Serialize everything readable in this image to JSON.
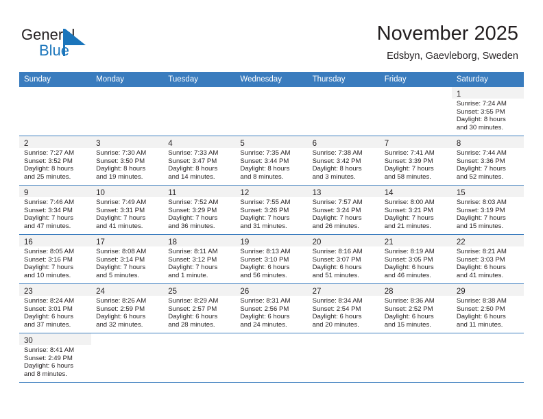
{
  "brand": {
    "line1": "General",
    "line2": "Blue",
    "triangle_color": "#1b75bb",
    "text_color": "#231f20"
  },
  "header": {
    "title": "November 2025",
    "subtitle": "Edsbyn, Gaevleborg, Sweden"
  },
  "theme": {
    "header_bg": "#3a7cbe",
    "header_text": "#ffffff",
    "daynum_bg": "#f2f2f2",
    "row_border": "#3a7cbe",
    "body_text": "#231f20"
  },
  "weekdays": [
    "Sunday",
    "Monday",
    "Tuesday",
    "Wednesday",
    "Thursday",
    "Friday",
    "Saturday"
  ],
  "weeks": [
    [
      {
        "day": "",
        "sunrise": "",
        "sunset": "",
        "daylight1": "",
        "daylight2": ""
      },
      {
        "day": "",
        "sunrise": "",
        "sunset": "",
        "daylight1": "",
        "daylight2": ""
      },
      {
        "day": "",
        "sunrise": "",
        "sunset": "",
        "daylight1": "",
        "daylight2": ""
      },
      {
        "day": "",
        "sunrise": "",
        "sunset": "",
        "daylight1": "",
        "daylight2": ""
      },
      {
        "day": "",
        "sunrise": "",
        "sunset": "",
        "daylight1": "",
        "daylight2": ""
      },
      {
        "day": "",
        "sunrise": "",
        "sunset": "",
        "daylight1": "",
        "daylight2": ""
      },
      {
        "day": "1",
        "sunrise": "Sunrise: 7:24 AM",
        "sunset": "Sunset: 3:55 PM",
        "daylight1": "Daylight: 8 hours",
        "daylight2": "and 30 minutes."
      }
    ],
    [
      {
        "day": "2",
        "sunrise": "Sunrise: 7:27 AM",
        "sunset": "Sunset: 3:52 PM",
        "daylight1": "Daylight: 8 hours",
        "daylight2": "and 25 minutes."
      },
      {
        "day": "3",
        "sunrise": "Sunrise: 7:30 AM",
        "sunset": "Sunset: 3:50 PM",
        "daylight1": "Daylight: 8 hours",
        "daylight2": "and 19 minutes."
      },
      {
        "day": "4",
        "sunrise": "Sunrise: 7:33 AM",
        "sunset": "Sunset: 3:47 PM",
        "daylight1": "Daylight: 8 hours",
        "daylight2": "and 14 minutes."
      },
      {
        "day": "5",
        "sunrise": "Sunrise: 7:35 AM",
        "sunset": "Sunset: 3:44 PM",
        "daylight1": "Daylight: 8 hours",
        "daylight2": "and 8 minutes."
      },
      {
        "day": "6",
        "sunrise": "Sunrise: 7:38 AM",
        "sunset": "Sunset: 3:42 PM",
        "daylight1": "Daylight: 8 hours",
        "daylight2": "and 3 minutes."
      },
      {
        "day": "7",
        "sunrise": "Sunrise: 7:41 AM",
        "sunset": "Sunset: 3:39 PM",
        "daylight1": "Daylight: 7 hours",
        "daylight2": "and 58 minutes."
      },
      {
        "day": "8",
        "sunrise": "Sunrise: 7:44 AM",
        "sunset": "Sunset: 3:36 PM",
        "daylight1": "Daylight: 7 hours",
        "daylight2": "and 52 minutes."
      }
    ],
    [
      {
        "day": "9",
        "sunrise": "Sunrise: 7:46 AM",
        "sunset": "Sunset: 3:34 PM",
        "daylight1": "Daylight: 7 hours",
        "daylight2": "and 47 minutes."
      },
      {
        "day": "10",
        "sunrise": "Sunrise: 7:49 AM",
        "sunset": "Sunset: 3:31 PM",
        "daylight1": "Daylight: 7 hours",
        "daylight2": "and 41 minutes."
      },
      {
        "day": "11",
        "sunrise": "Sunrise: 7:52 AM",
        "sunset": "Sunset: 3:29 PM",
        "daylight1": "Daylight: 7 hours",
        "daylight2": "and 36 minutes."
      },
      {
        "day": "12",
        "sunrise": "Sunrise: 7:55 AM",
        "sunset": "Sunset: 3:26 PM",
        "daylight1": "Daylight: 7 hours",
        "daylight2": "and 31 minutes."
      },
      {
        "day": "13",
        "sunrise": "Sunrise: 7:57 AM",
        "sunset": "Sunset: 3:24 PM",
        "daylight1": "Daylight: 7 hours",
        "daylight2": "and 26 minutes."
      },
      {
        "day": "14",
        "sunrise": "Sunrise: 8:00 AM",
        "sunset": "Sunset: 3:21 PM",
        "daylight1": "Daylight: 7 hours",
        "daylight2": "and 21 minutes."
      },
      {
        "day": "15",
        "sunrise": "Sunrise: 8:03 AM",
        "sunset": "Sunset: 3:19 PM",
        "daylight1": "Daylight: 7 hours",
        "daylight2": "and 15 minutes."
      }
    ],
    [
      {
        "day": "16",
        "sunrise": "Sunrise: 8:05 AM",
        "sunset": "Sunset: 3:16 PM",
        "daylight1": "Daylight: 7 hours",
        "daylight2": "and 10 minutes."
      },
      {
        "day": "17",
        "sunrise": "Sunrise: 8:08 AM",
        "sunset": "Sunset: 3:14 PM",
        "daylight1": "Daylight: 7 hours",
        "daylight2": "and 5 minutes."
      },
      {
        "day": "18",
        "sunrise": "Sunrise: 8:11 AM",
        "sunset": "Sunset: 3:12 PM",
        "daylight1": "Daylight: 7 hours",
        "daylight2": "and 1 minute."
      },
      {
        "day": "19",
        "sunrise": "Sunrise: 8:13 AM",
        "sunset": "Sunset: 3:10 PM",
        "daylight1": "Daylight: 6 hours",
        "daylight2": "and 56 minutes."
      },
      {
        "day": "20",
        "sunrise": "Sunrise: 8:16 AM",
        "sunset": "Sunset: 3:07 PM",
        "daylight1": "Daylight: 6 hours",
        "daylight2": "and 51 minutes."
      },
      {
        "day": "21",
        "sunrise": "Sunrise: 8:19 AM",
        "sunset": "Sunset: 3:05 PM",
        "daylight1": "Daylight: 6 hours",
        "daylight2": "and 46 minutes."
      },
      {
        "day": "22",
        "sunrise": "Sunrise: 8:21 AM",
        "sunset": "Sunset: 3:03 PM",
        "daylight1": "Daylight: 6 hours",
        "daylight2": "and 41 minutes."
      }
    ],
    [
      {
        "day": "23",
        "sunrise": "Sunrise: 8:24 AM",
        "sunset": "Sunset: 3:01 PM",
        "daylight1": "Daylight: 6 hours",
        "daylight2": "and 37 minutes."
      },
      {
        "day": "24",
        "sunrise": "Sunrise: 8:26 AM",
        "sunset": "Sunset: 2:59 PM",
        "daylight1": "Daylight: 6 hours",
        "daylight2": "and 32 minutes."
      },
      {
        "day": "25",
        "sunrise": "Sunrise: 8:29 AM",
        "sunset": "Sunset: 2:57 PM",
        "daylight1": "Daylight: 6 hours",
        "daylight2": "and 28 minutes."
      },
      {
        "day": "26",
        "sunrise": "Sunrise: 8:31 AM",
        "sunset": "Sunset: 2:56 PM",
        "daylight1": "Daylight: 6 hours",
        "daylight2": "and 24 minutes."
      },
      {
        "day": "27",
        "sunrise": "Sunrise: 8:34 AM",
        "sunset": "Sunset: 2:54 PM",
        "daylight1": "Daylight: 6 hours",
        "daylight2": "and 20 minutes."
      },
      {
        "day": "28",
        "sunrise": "Sunrise: 8:36 AM",
        "sunset": "Sunset: 2:52 PM",
        "daylight1": "Daylight: 6 hours",
        "daylight2": "and 15 minutes."
      },
      {
        "day": "29",
        "sunrise": "Sunrise: 8:38 AM",
        "sunset": "Sunset: 2:50 PM",
        "daylight1": "Daylight: 6 hours",
        "daylight2": "and 11 minutes."
      }
    ],
    [
      {
        "day": "30",
        "sunrise": "Sunrise: 8:41 AM",
        "sunset": "Sunset: 2:49 PM",
        "daylight1": "Daylight: 6 hours",
        "daylight2": "and 8 minutes."
      },
      {
        "day": "",
        "sunrise": "",
        "sunset": "",
        "daylight1": "",
        "daylight2": ""
      },
      {
        "day": "",
        "sunrise": "",
        "sunset": "",
        "daylight1": "",
        "daylight2": ""
      },
      {
        "day": "",
        "sunrise": "",
        "sunset": "",
        "daylight1": "",
        "daylight2": ""
      },
      {
        "day": "",
        "sunrise": "",
        "sunset": "",
        "daylight1": "",
        "daylight2": ""
      },
      {
        "day": "",
        "sunrise": "",
        "sunset": "",
        "daylight1": "",
        "daylight2": ""
      },
      {
        "day": "",
        "sunrise": "",
        "sunset": "",
        "daylight1": "",
        "daylight2": ""
      }
    ]
  ]
}
